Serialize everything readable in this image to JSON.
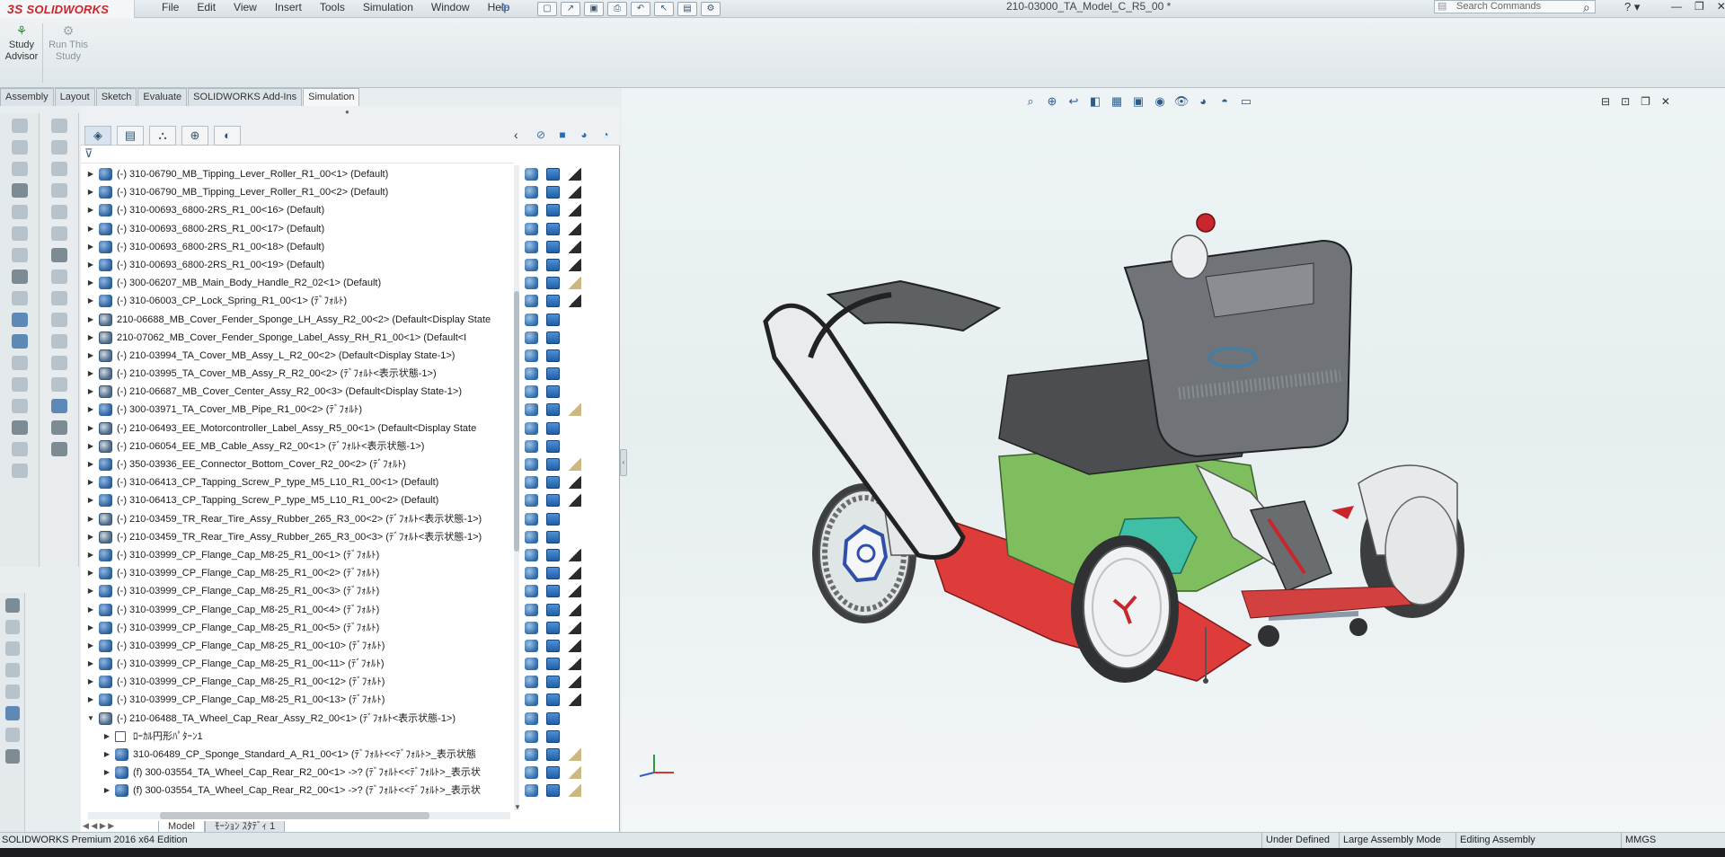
{
  "app": {
    "logo": "SOLIDWORKS",
    "logo_prefix": "3S",
    "document_title": "210-03000_TA_Model_C_R5_00 *",
    "search_placeholder": "Search Commands"
  },
  "menu": [
    "File",
    "Edit",
    "View",
    "Insert",
    "Tools",
    "Simulation",
    "Window",
    "Help"
  ],
  "command_manager": {
    "buttons": [
      {
        "label_1": "Study",
        "label_2": "Advisor",
        "enabled": true
      },
      {
        "label_1": "Run This",
        "label_2": "Study",
        "enabled": false
      }
    ]
  },
  "tabs": [
    {
      "label": "Assembly",
      "active": false
    },
    {
      "label": "Layout",
      "active": false
    },
    {
      "label": "Sketch",
      "active": false
    },
    {
      "label": "Evaluate",
      "active": false
    },
    {
      "label": "SOLIDWORKS Add-Ins",
      "active": false
    },
    {
      "label": "Simulation",
      "active": true
    }
  ],
  "tree": [
    {
      "text": "(-) 310-06790_MB_Tipping_Lever_Roller_R1_00<1> (Default)",
      "indent": 0,
      "kind": "part",
      "expand": "right",
      "c3": "dark"
    },
    {
      "text": "(-) 310-06790_MB_Tipping_Lever_Roller_R1_00<2> (Default)",
      "indent": 0,
      "kind": "part",
      "expand": "right",
      "c3": "dark"
    },
    {
      "text": "(-) 310-00693_6800-2RS_R1_00<16> (Default)",
      "indent": 0,
      "kind": "part",
      "expand": "right",
      "c3": "dark"
    },
    {
      "text": "(-) 310-00693_6800-2RS_R1_00<17> (Default)",
      "indent": 0,
      "kind": "part",
      "expand": "right",
      "c3": "dark"
    },
    {
      "text": "(-) 310-00693_6800-2RS_R1_00<18> (Default)",
      "indent": 0,
      "kind": "part",
      "expand": "right",
      "c3": "dark"
    },
    {
      "text": "(-) 310-00693_6800-2RS_R1_00<19> (Default)",
      "indent": 0,
      "kind": "part",
      "expand": "right",
      "c3": "dark"
    },
    {
      "text": "(-) 300-06207_MB_Main_Body_Handle_R2_02<1> (Default)",
      "indent": 0,
      "kind": "part",
      "expand": "right",
      "c3": "light"
    },
    {
      "text": "(-) 310-06003_CP_Lock_Spring_R1_00<1> (ﾃﾞﾌｫﾙﾄ)",
      "indent": 0,
      "kind": "part",
      "expand": "right",
      "c3": "dark"
    },
    {
      "text": "210-06688_MB_Cover_Fender_Sponge_LH_Assy_R2_00<2> (Default<Display State",
      "indent": 0,
      "kind": "asm",
      "expand": "right",
      "c3": "none"
    },
    {
      "text": "210-07062_MB_Cover_Fender_Sponge_Label_Assy_RH_R1_00<1> (Default<I",
      "indent": 0,
      "kind": "asm",
      "expand": "right",
      "c3": "none"
    },
    {
      "text": "(-) 210-03994_TA_Cover_MB_Assy_L_R2_00<2> (Default<Display State-1>)",
      "indent": 0,
      "kind": "asm",
      "expand": "right",
      "c3": "none"
    },
    {
      "text": "(-) 210-03995_TA_Cover_MB_Assy_R_R2_00<2> (ﾃﾞﾌｫﾙﾄ<表示状態-1>)",
      "indent": 0,
      "kind": "asm",
      "expand": "right",
      "c3": "none"
    },
    {
      "text": "(-) 210-06687_MB_Cover_Center_Assy_R2_00<3> (Default<Display State-1>)",
      "indent": 0,
      "kind": "asm",
      "expand": "right",
      "c3": "none"
    },
    {
      "text": "(-) 300-03971_TA_Cover_MB_Pipe_R1_00<2> (ﾃﾞﾌｫﾙﾄ)",
      "indent": 0,
      "kind": "part",
      "expand": "right",
      "c3": "light"
    },
    {
      "text": "(-) 210-06493_EE_Motorcontroller_Label_Assy_R5_00<1> (Default<Display State",
      "indent": 0,
      "kind": "asm",
      "expand": "right",
      "c3": "none"
    },
    {
      "text": "(-) 210-06054_EE_MB_Cable_Assy_R2_00<1> (ﾃﾞﾌｫﾙﾄ<表示状態-1>)",
      "indent": 0,
      "kind": "asm",
      "expand": "right",
      "c3": "none"
    },
    {
      "text": "(-) 350-03936_EE_Connector_Bottom_Cover_R2_00<2> (ﾃﾞﾌｫﾙﾄ)",
      "indent": 0,
      "kind": "part",
      "expand": "right",
      "c3": "light"
    },
    {
      "text": "(-) 310-06413_CP_Tapping_Screw_P_type_M5_L10_R1_00<1> (Default)",
      "indent": 0,
      "kind": "part",
      "expand": "right",
      "c3": "dark"
    },
    {
      "text": "(-) 310-06413_CP_Tapping_Screw_P_type_M5_L10_R1_00<2> (Default)",
      "indent": 0,
      "kind": "part",
      "expand": "right",
      "c3": "dark"
    },
    {
      "text": "(-) 210-03459_TR_Rear_Tire_Assy_Rubber_265_R3_00<2> (ﾃﾞﾌｫﾙﾄ<表示状態-1>)",
      "indent": 0,
      "kind": "asm",
      "expand": "right",
      "c3": "none"
    },
    {
      "text": "(-) 210-03459_TR_Rear_Tire_Assy_Rubber_265_R3_00<3> (ﾃﾞﾌｫﾙﾄ<表示状態-1>)",
      "indent": 0,
      "kind": "asm",
      "expand": "right",
      "c3": "none"
    },
    {
      "text": "(-) 310-03999_CP_Flange_Cap_M8-25_R1_00<1> (ﾃﾞﾌｫﾙﾄ)",
      "indent": 0,
      "kind": "part",
      "expand": "right",
      "c3": "dark"
    },
    {
      "text": "(-) 310-03999_CP_Flange_Cap_M8-25_R1_00<2> (ﾃﾞﾌｫﾙﾄ)",
      "indent": 0,
      "kind": "part",
      "expand": "right",
      "c3": "dark"
    },
    {
      "text": "(-) 310-03999_CP_Flange_Cap_M8-25_R1_00<3> (ﾃﾞﾌｫﾙﾄ)",
      "indent": 0,
      "kind": "part",
      "expand": "right",
      "c3": "dark"
    },
    {
      "text": "(-) 310-03999_CP_Flange_Cap_M8-25_R1_00<4> (ﾃﾞﾌｫﾙﾄ)",
      "indent": 0,
      "kind": "part",
      "expand": "right",
      "c3": "dark"
    },
    {
      "text": "(-) 310-03999_CP_Flange_Cap_M8-25_R1_00<5> (ﾃﾞﾌｫﾙﾄ)",
      "indent": 0,
      "kind": "part",
      "expand": "right",
      "c3": "dark"
    },
    {
      "text": "(-) 310-03999_CP_Flange_Cap_M8-25_R1_00<10> (ﾃﾞﾌｫﾙﾄ)",
      "indent": 0,
      "kind": "part",
      "expand": "right",
      "c3": "dark"
    },
    {
      "text": "(-) 310-03999_CP_Flange_Cap_M8-25_R1_00<11> (ﾃﾞﾌｫﾙﾄ)",
      "indent": 0,
      "kind": "part",
      "expand": "right",
      "c3": "dark"
    },
    {
      "text": "(-) 310-03999_CP_Flange_Cap_M8-25_R1_00<12> (ﾃﾞﾌｫﾙﾄ)",
      "indent": 0,
      "kind": "part",
      "expand": "right",
      "c3": "dark"
    },
    {
      "text": "(-) 310-03999_CP_Flange_Cap_M8-25_R1_00<13> (ﾃﾞﾌｫﾙﾄ)",
      "indent": 0,
      "kind": "part",
      "expand": "right",
      "c3": "dark"
    },
    {
      "text": "(-) 210-06488_TA_Wheel_Cap_Rear_Assy_R2_00<1> (ﾃﾞﾌｫﾙﾄ<表示状態-1>)",
      "indent": 0,
      "kind": "asm",
      "expand": "down",
      "c3": "none"
    },
    {
      "text": "ﾛｰｶﾙ円形ﾊﾟﾀｰﾝ1",
      "indent": 1,
      "kind": "pattern",
      "expand": "right",
      "c3": "none"
    },
    {
      "text": "310-06489_CP_Sponge_Standard_A_R1_00<1> (ﾃﾞﾌｫﾙﾄ<<ﾃﾞﾌｫﾙﾄ>_表示状態",
      "indent": 1,
      "kind": "part",
      "expand": "right",
      "c3": "light"
    },
    {
      "text": "(f) 300-03554_TA_Wheel_Cap_Rear_R2_00<1> ->? (ﾃﾞﾌｫﾙﾄ<<ﾃﾞﾌｫﾙﾄ>_表示状",
      "indent": 1,
      "kind": "part",
      "expand": "right",
      "c3": "light"
    },
    {
      "text": "(f) 300-03554_TA_Wheel_Cap_Rear_R2_00<1> ->? (ﾃﾞﾌｫﾙﾄ<<ﾃﾞﾌｫﾙﾄ>_表示状",
      "indent": 1,
      "kind": "part",
      "expand": "right",
      "c3": "light"
    }
  ],
  "bottom_tabs": [
    {
      "label": "Model",
      "active": true
    },
    {
      "label": "ﾓｰｼｮﾝ ｽﾀﾃﾞｨ 1",
      "active": false
    }
  ],
  "status": {
    "edition": "SOLIDWORKS Premium 2016 x64 Edition",
    "items": [
      "Under Defined",
      "Large Assembly Mode",
      "Editing Assembly",
      "MMGS"
    ]
  },
  "colors": {
    "accent": "#2f6aa6",
    "brand": "#c8262c",
    "background": "#eef4f5"
  }
}
